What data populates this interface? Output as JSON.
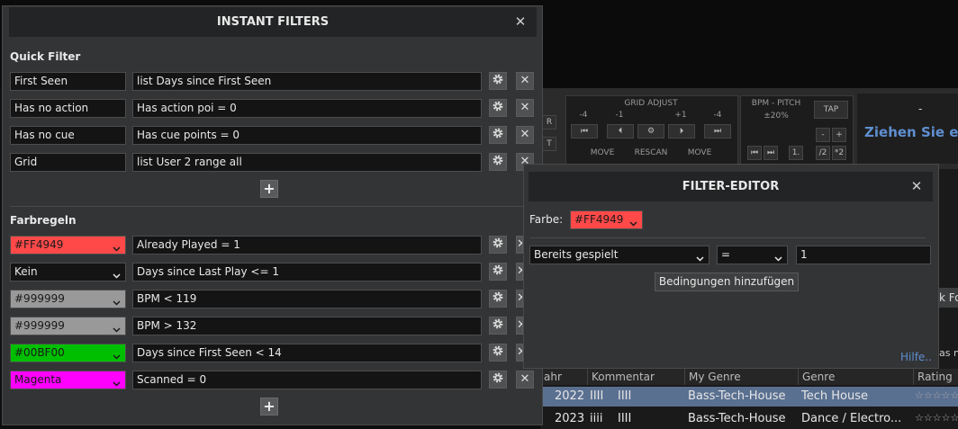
{
  "instant_filters": {
    "title": "INSTANT FILTERS",
    "close_glyph": "✕",
    "quick_filter_title": "Quick Filter",
    "quick_filters": [
      {
        "name": "First Seen",
        "expression": "list Days since First Seen"
      },
      {
        "name": "Has no action",
        "expression": "Has action poi = 0"
      },
      {
        "name": "Has no cue",
        "expression": "Has cue points = 0"
      },
      {
        "name": "Grid",
        "expression": "list User 2 range all"
      }
    ],
    "color_rules_title": "Farbregeln",
    "color_rules": [
      {
        "color_label": "#FF4949",
        "bg": "#ff4949",
        "fg": "#1a1a1a",
        "expression": "Already Played = 1"
      },
      {
        "color_label": "Kein",
        "bg": "#141414",
        "fg": "#e8e8e8",
        "expression": "Days since Last Play <= 1"
      },
      {
        "color_label": "#999999",
        "bg": "#999999",
        "fg": "#1a1a1a",
        "expression": "BPM < 119"
      },
      {
        "color_label": "#999999",
        "bg": "#999999",
        "fg": "#1a1a1a",
        "expression": "BPM > 132"
      },
      {
        "color_label": "#00BF00",
        "bg": "#00bf00",
        "fg": "#1a1a1a",
        "expression": "Days since First Seen < 14"
      },
      {
        "color_label": "Magenta",
        "bg": "#ff00ff",
        "fg": "#1a1a1a",
        "expression": "Scanned = 0"
      }
    ],
    "settings_icon": "gear-icon",
    "delete_icon": "close-icon",
    "add_icon": "plus-icon",
    "add_glyph": "+"
  },
  "filter_editor": {
    "title": "FILTER-EDITOR",
    "close_glyph": "✕",
    "color_label": "Farbe:",
    "color_value": "#FF4949",
    "color_hex": "#ff4949",
    "field_value": "Bereits gespielt",
    "operator_value": "=",
    "value": "1",
    "add_condition_label": "Bedingungen hinzufügen",
    "help_link": "Hilfe.."
  },
  "deck": {
    "grid_adjust_label": "GRID ADJUST",
    "grid_values": [
      "-4",
      "-1",
      "+1",
      "-4"
    ],
    "move_label_1": "MOVE",
    "rescan_label": "RESCAN",
    "move_label_2": "MOVE",
    "bpm_pitch_label": "BPM - PITCH",
    "pitch_range": "±20%",
    "tap_label": "TAP",
    "pitch_buttons": [
      "-",
      "+",
      "/2",
      "*2"
    ],
    "one_label": "1.",
    "side_labels": [
      "R",
      "T"
    ],
    "dash_label": "-",
    "drop_hint": "Ziehen Sie ein",
    "partial_tab": "k Fo",
    "partial_text": "as no"
  },
  "library": {
    "columns": [
      "ahr",
      "Kommentar",
      "My Genre",
      "Genre",
      "Rating"
    ],
    "rows": [
      {
        "year": "2022",
        "comment_1": "IIII",
        "comment_2": "IIII",
        "my_genre": "Bass-Tech-House",
        "genre": "Tech House",
        "rating": "☆☆☆☆☆"
      },
      {
        "year": "2023",
        "comment_1": "iiii",
        "comment_2": "IIII",
        "my_genre": "Bass-Tech-House",
        "genre": "Dance / Electro...",
        "rating": "☆☆☆☆☆"
      }
    ]
  }
}
